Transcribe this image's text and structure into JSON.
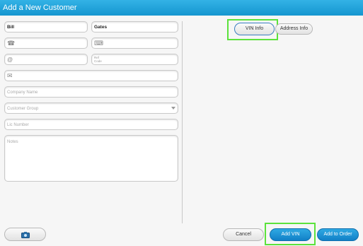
{
  "window": {
    "title": "Add a New Customer"
  },
  "form": {
    "first_name": "Bill",
    "last_name": "Gates",
    "ref_code_label": "Ref Code",
    "company_placeholder": "Company Name",
    "customer_group_placeholder": "Customer Group",
    "lic_number_placeholder": "Lic Number",
    "notes_placeholder": "Notes"
  },
  "tabs": {
    "vin_info": "VIN Info",
    "address_info": "Address Info"
  },
  "buttons": {
    "cancel": "Cancel",
    "add_vin": "Add VIN",
    "add_to_order": "Add to Order"
  },
  "icons": {
    "phone": "☎",
    "fax": "⌨",
    "email": "@",
    "address": "✉",
    "camera": "camera-icon"
  },
  "colors": {
    "title_bar": "#1a9fd8",
    "primary_button": "#1a8fd0",
    "highlight": "#5ce23c"
  }
}
